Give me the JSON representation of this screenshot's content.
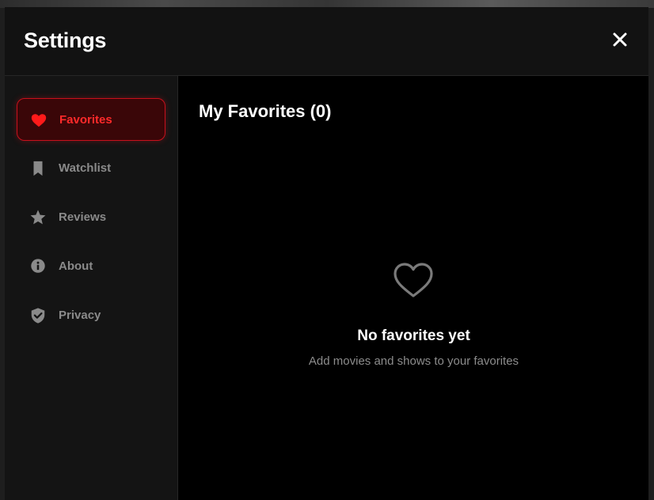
{
  "modal": {
    "title": "Settings",
    "close_icon": "close-icon"
  },
  "sidebar": {
    "items": [
      {
        "label": "Favorites",
        "icon": "heart-icon",
        "active": true
      },
      {
        "label": "Watchlist",
        "icon": "bookmark-icon",
        "active": false
      },
      {
        "label": "Reviews",
        "icon": "star-icon",
        "active": false
      },
      {
        "label": "About",
        "icon": "info-icon",
        "active": false
      },
      {
        "label": "Privacy",
        "icon": "shield-check-icon",
        "active": false
      }
    ]
  },
  "content": {
    "title": "My Favorites (0)",
    "empty_state": {
      "icon": "heart-outline-icon",
      "title": "No favorites yet",
      "subtitle": "Add movies and shows to your favorites"
    }
  },
  "colors": {
    "accent": "#e50914",
    "active_bg": "#3a0608",
    "muted_text": "#8a8a8a",
    "panel_bg": "#141414"
  }
}
